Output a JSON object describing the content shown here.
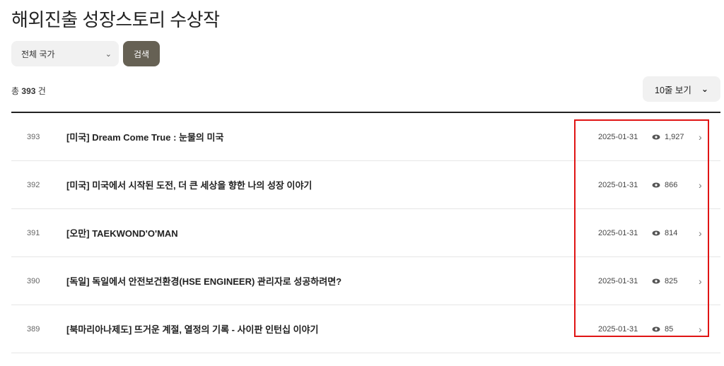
{
  "page": {
    "title": "해외진출 성장스토리 수상작"
  },
  "filter": {
    "country_select": "전체 국가",
    "search_label": "검색"
  },
  "summary": {
    "prefix": "총",
    "count": "393",
    "suffix": "건"
  },
  "page_size": {
    "label": "10줄 보기"
  },
  "rows": [
    {
      "num": "393",
      "subject": "[미국] Dream Come True : 눈물의 미국",
      "date": "2025-01-31",
      "views": "1,927"
    },
    {
      "num": "392",
      "subject": "[미국] 미국에서 시작된 도전, 더 큰 세상을 향한 나의 성장 이야기",
      "date": "2025-01-31",
      "views": "866"
    },
    {
      "num": "391",
      "subject": "[오만] TAEKWOND'O'MAN",
      "date": "2025-01-31",
      "views": "814"
    },
    {
      "num": "390",
      "subject": "[독일] 독일에서 안전보건환경(HSE ENGINEER) 관리자로 성공하려면?",
      "date": "2025-01-31",
      "views": "825"
    },
    {
      "num": "389",
      "subject": "[북마리아나제도] 뜨거운 계절, 열정의 기록 - 사이판 인턴십 이야기",
      "date": "2025-01-31",
      "views": "85"
    }
  ],
  "colors": {
    "highlight": "#e01414",
    "search_button": "#666154"
  }
}
